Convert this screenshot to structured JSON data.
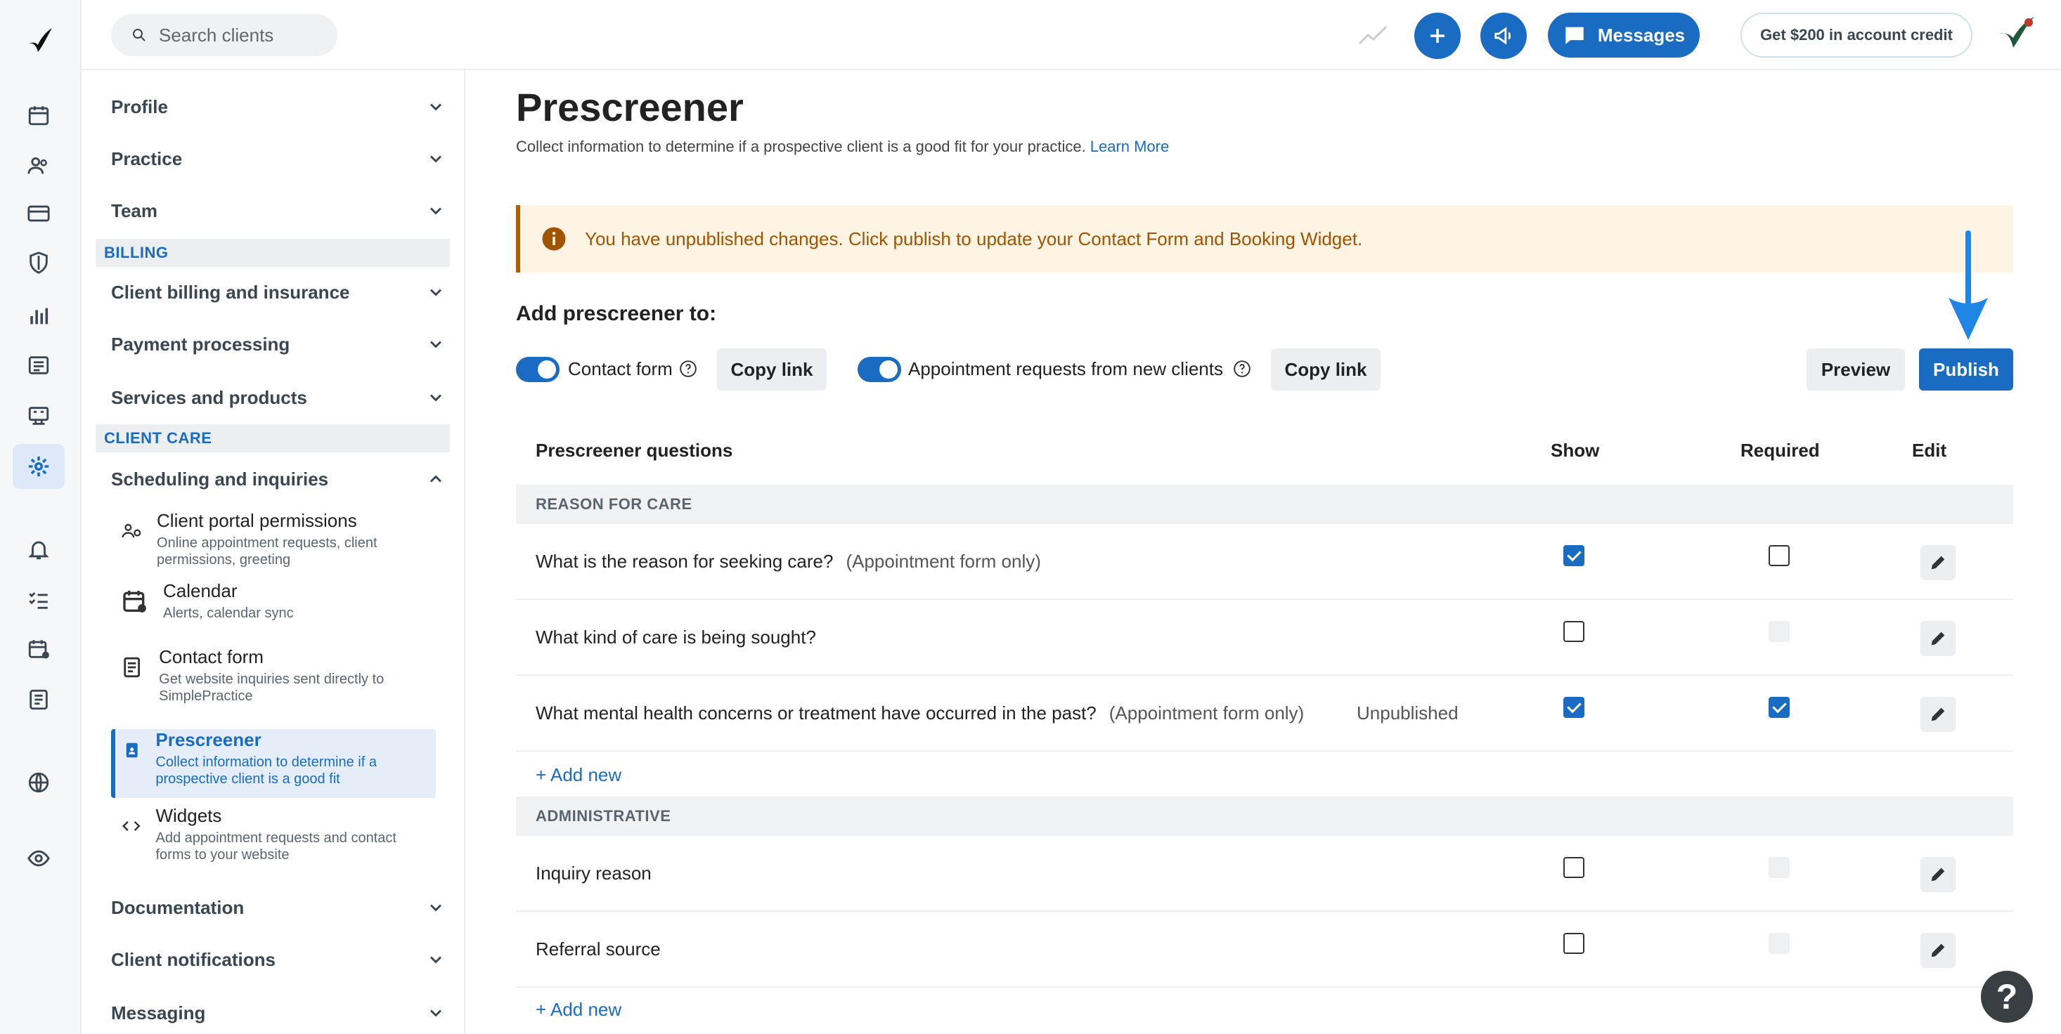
{
  "topbar": {
    "search_placeholder": "Search clients",
    "messages_label": "Messages",
    "credit_label": "Get $200 in account credit"
  },
  "nav": {
    "top_items": [
      {
        "label": "Profile"
      },
      {
        "label": "Practice"
      },
      {
        "label": "Team"
      }
    ],
    "billing_header": "BILLING",
    "billing_items": [
      {
        "label": "Client billing and insurance"
      },
      {
        "label": "Payment processing"
      },
      {
        "label": "Services and products"
      }
    ],
    "client_care_header": "CLIENT CARE",
    "scheduling_label": "Scheduling and inquiries",
    "sub_items": [
      {
        "title": "Client portal permissions",
        "desc": "Online appointment requests, client permissions, greeting"
      },
      {
        "title": "Calendar",
        "desc": "Alerts, calendar sync"
      },
      {
        "title": "Contact form",
        "desc": "Get website inquiries sent directly to SimplePractice"
      },
      {
        "title": "Prescreener",
        "desc": "Collect information to determine if a prospective client is a good fit"
      },
      {
        "title": "Widgets",
        "desc": "Add appointment requests and contact forms to your website"
      }
    ],
    "bottom_items": [
      {
        "label": "Documentation"
      },
      {
        "label": "Client notifications"
      },
      {
        "label": "Messaging"
      }
    ]
  },
  "page": {
    "title": "Prescreener",
    "description": "Collect information to determine if a prospective client is a good fit for your practice.",
    "learn_more": "Learn More",
    "alert": "You have unpublished changes. Click publish to update your Contact Form and Booking Widget.",
    "add_to_label": "Add prescreener to:",
    "contact_form_label": "Contact form",
    "copy_link_label": "Copy link",
    "appointment_requests_label": "Appointment requests from new clients",
    "preview_label": "Preview",
    "publish_label": "Publish"
  },
  "table": {
    "headers": {
      "questions": "Prescreener questions",
      "show": "Show",
      "required": "Required",
      "edit": "Edit"
    },
    "groups": [
      {
        "name": "REASON FOR CARE",
        "rows": [
          {
            "question": "What is the reason for seeking care?",
            "note": "(Appointment form only)",
            "status": "",
            "show": true,
            "required": false,
            "required_enabled": true
          },
          {
            "question": "What kind of care is being sought?",
            "note": "",
            "status": "",
            "show": false,
            "required": false,
            "required_enabled": false
          },
          {
            "question": "What mental health concerns or treatment have occurred in the past?",
            "note": "(Appointment form only)",
            "status": "Unpublished",
            "show": true,
            "required": true,
            "required_enabled": true
          }
        ]
      },
      {
        "name": "ADMINISTRATIVE",
        "rows": [
          {
            "question": "Inquiry reason",
            "note": "",
            "status": "",
            "show": false,
            "required": false,
            "required_enabled": false
          },
          {
            "question": "Referral source",
            "note": "",
            "status": "",
            "show": false,
            "required": false,
            "required_enabled": false
          }
        ]
      }
    ],
    "add_new_label": "+ Add new"
  },
  "help_fab": "?",
  "colors": {
    "accent": "#1a6cc2",
    "alert_bg": "#fdf4e4",
    "alert_text": "#a25300"
  }
}
